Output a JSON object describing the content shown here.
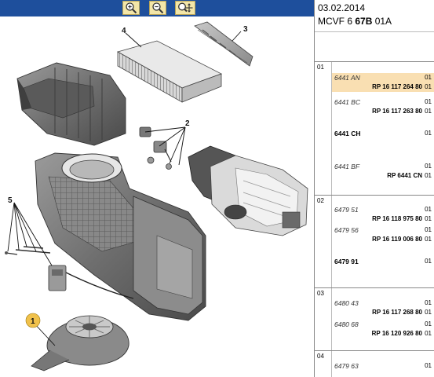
{
  "header": {
    "date": "03.02.2014",
    "model_prefix": "MCVF 6 ",
    "model_bold": "67B",
    "model_suffix": " 01A"
  },
  "toolbar": {
    "buttons": [
      {
        "name": "zoom-in-icon"
      },
      {
        "name": "zoom-out-icon"
      },
      {
        "name": "zoom-fit-icon"
      }
    ],
    "colors": {
      "bar": "#1e4f9c",
      "button": "#f3e6a8"
    }
  },
  "diagram": {
    "callouts": [
      "1",
      "2",
      "3",
      "4",
      "5"
    ]
  },
  "groups": [
    {
      "num": "01",
      "rows": [
        {
          "code": "6441 AN",
          "qty": "01",
          "highlight": true
        },
        {
          "ref": "RP 16 117 264 80",
          "qty": "01",
          "highlight": true
        },
        {
          "code": "6441 BC",
          "qty": "01"
        },
        {
          "ref": "RP 16 117 263 80",
          "qty": "01"
        },
        {
          "bold": "6441 CH",
          "qty": "01"
        },
        {
          "code": "6441 BF",
          "qty": "01"
        },
        {
          "ref": "RP 6441 CN",
          "qty": "01"
        }
      ]
    },
    {
      "num": "02",
      "rows": [
        {
          "code": "6479 51",
          "qty": "01"
        },
        {
          "ref": "RP 16 118 975 80",
          "qty": "01"
        },
        {
          "code": "6479 56",
          "qty": "01"
        },
        {
          "ref": "RP 16 119 006 80",
          "qty": "01"
        },
        {
          "bold": "6479 91",
          "qty": "01"
        }
      ]
    },
    {
      "num": "03",
      "rows": [
        {
          "code": "6480 43",
          "qty": "01"
        },
        {
          "ref": "RP 16 117 268 80",
          "qty": "01"
        },
        {
          "code": "6480 68",
          "qty": "01"
        },
        {
          "ref": "RP 16 120 926 80",
          "qty": "01"
        }
      ]
    },
    {
      "num": "04",
      "rows": [
        {
          "code": "6479 63",
          "qty": "01"
        }
      ]
    }
  ]
}
